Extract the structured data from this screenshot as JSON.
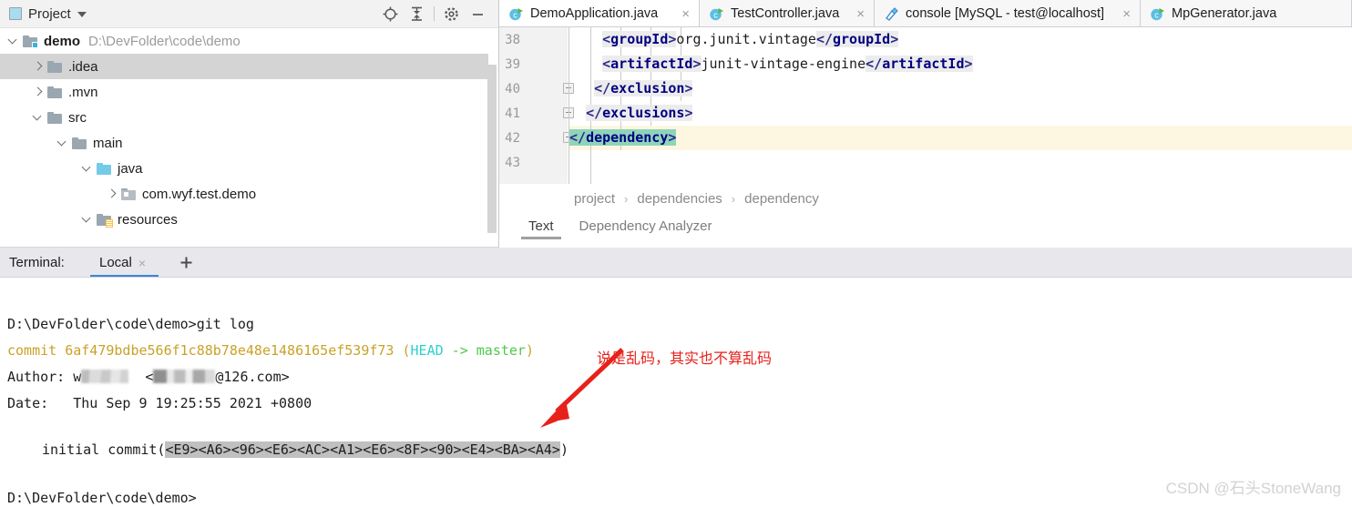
{
  "project_panel": {
    "title": "Project",
    "icons": [
      "project-square-icon",
      "chevron-down-icon",
      "locate-icon",
      "collapse-all-icon",
      "settings-gear-icon",
      "minimize-icon"
    ],
    "tree": [
      {
        "label": "demo",
        "path": "D:\\DevFolder\\code\\demo",
        "arrow": "down",
        "icon": "module-folder-icon",
        "depth": 0,
        "bold": true,
        "selected": false
      },
      {
        "label": ".idea",
        "path": "",
        "arrow": "right",
        "icon": "folder-icon",
        "depth": 1,
        "bold": false,
        "selected": true
      },
      {
        "label": ".mvn",
        "path": "",
        "arrow": "right",
        "icon": "folder-icon",
        "depth": 1,
        "bold": false,
        "selected": false
      },
      {
        "label": "src",
        "path": "",
        "arrow": "down",
        "icon": "folder-icon",
        "depth": 1,
        "bold": false,
        "selected": false
      },
      {
        "label": "main",
        "path": "",
        "arrow": "down",
        "icon": "folder-icon",
        "depth": 2,
        "bold": false,
        "selected": false
      },
      {
        "label": "java",
        "path": "",
        "arrow": "down",
        "icon": "source-root-folder-icon",
        "depth": 3,
        "bold": false,
        "selected": false
      },
      {
        "label": "com.wyf.test.demo",
        "path": "",
        "arrow": "right",
        "icon": "package-icon",
        "depth": 4,
        "bold": false,
        "selected": false
      },
      {
        "label": "resources",
        "path": "",
        "arrow": "down",
        "icon": "resources-folder-icon",
        "depth": 3,
        "bold": false,
        "selected": false
      }
    ]
  },
  "editor": {
    "tabs": [
      {
        "label": "DemoApplication.java",
        "icon": "java-class-run-icon",
        "close": "×",
        "active": true
      },
      {
        "label": "TestController.java",
        "icon": "java-class-run-icon",
        "close": "×",
        "active": false
      },
      {
        "label": "console [MySQL - test@localhost]",
        "icon": "database-console-icon",
        "close": "×",
        "active": false
      },
      {
        "label": "MpGenerator.java",
        "icon": "java-class-run-icon",
        "close": "",
        "active": false
      }
    ],
    "line_numbers": [
      "38",
      "39",
      "40",
      "41",
      "42",
      "43"
    ],
    "code": {
      "l38_open": "<groupId>",
      "l38_text": "org.junit.vintage",
      "l38_close": "</groupId>",
      "l39_open": "<artifactId>",
      "l39_text": "junit-vintage-engine",
      "l39_close": "</artifactId>",
      "l40": "</exclusion>",
      "l41": "</exclusions>",
      "l42": "</dependency>",
      "l43": ""
    },
    "breadcrumb": [
      "project",
      "dependencies",
      "dependency"
    ],
    "breadcrumb_separator": "›",
    "bottom_tabs": [
      {
        "label": "Text",
        "active": true
      },
      {
        "label": "Dependency Analyzer",
        "active": false
      }
    ]
  },
  "terminal": {
    "label": "Terminal:",
    "tab": {
      "label": "Local",
      "close": "×"
    },
    "add_icon": "plus-icon",
    "lines": {
      "prompt1": "D:\\DevFolder\\code\\demo>",
      "command1": "git log",
      "commit_word": "commit ",
      "commit_hash": "6af479bdbe566f1c88b78e48e1486165ef539f73",
      "paren_open": " (",
      "head": "HEAD",
      "arrow_master": " -> master",
      "paren_close": ")",
      "author_label": "Author: ",
      "author_prefix": "w",
      "author_at": "@126.com>",
      "author_bracket_open": "<",
      "date_label": "Date:   ",
      "date_value": "Thu Sep 9 19:25:55 2021 +0800",
      "message_prefix": "initial commit(",
      "message_hex": "<E9><A6><96><E6><AC><A1><E6><8F><90><E4><BA><A4>",
      "message_suffix": ")",
      "prompt2": "D:\\DevFolder\\code\\demo>"
    }
  },
  "annotation": {
    "text": "说是乱码，其实也不算乱码",
    "arrow_icon": "red-arrow-icon",
    "color": "#e8211b"
  },
  "watermark": {
    "text": "CSDN @石头StoneWang"
  },
  "colors": {
    "selection_gray": "#d4d4d4",
    "caret_line": "#fdf7e2",
    "code_selection_green": "#8fd3bb",
    "tag_name": "#000080",
    "terminal_yellow": "#c9a227",
    "terminal_cyan": "#2fd0d0",
    "terminal_green": "#4ec94e",
    "tab_underline_blue": "#3a87d8"
  }
}
